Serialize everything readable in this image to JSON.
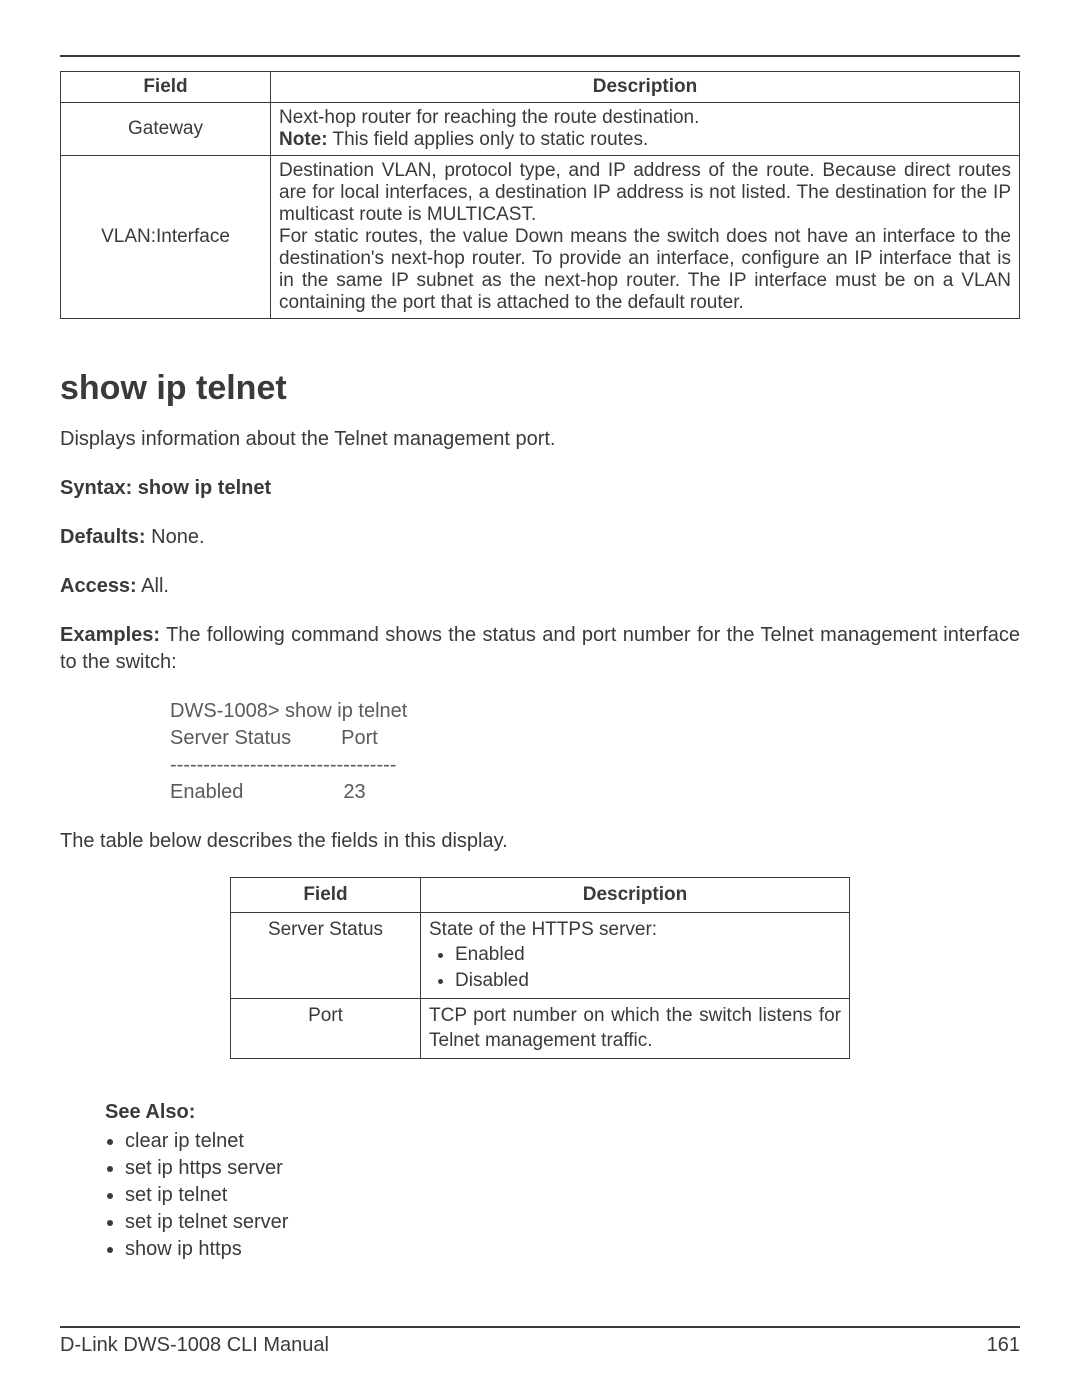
{
  "table1": {
    "headers": {
      "field": "Field",
      "description": "Description"
    },
    "rows": [
      {
        "field": "Gateway",
        "desc_line1": "Next-hop router for reaching the route destination.",
        "desc_note_label": "Note:",
        "desc_note_text": " This field applies only to static routes."
      },
      {
        "field": "VLAN:Interface",
        "desc_p1": "Destination VLAN, protocol type, and IP address of the route. Because direct routes are for local interfaces, a destination IP address is not listed. The destination for the IP multicast route is MULTICAST.",
        "desc_p2": "For static routes, the value Down means the switch does not have an interface to the destination's next-hop router. To provide an interface, configure an IP interface that is in the same IP subnet as the next-hop router. The IP interface must be on a VLAN containing the port that is attached to the default router."
      }
    ]
  },
  "command_heading": "show ip telnet",
  "intro": "Displays information about the Telnet management port.",
  "syntax_label": "Syntax: show ip telnet",
  "defaults_label": "Defaults:",
  "defaults_value": " None.",
  "access_label": "Access:",
  "access_value": " All.",
  "examples_label": "Examples:",
  "examples_text": " The following command shows the status and port number for the Telnet management interface to the switch:",
  "cli": "DWS-1008> show ip telnet\nServer Status         Port\n----------------------------------\nEnabled                  23",
  "desc_intro": "The table below describes the fields in this display.",
  "table2": {
    "headers": {
      "field": "Field",
      "description": "Description"
    },
    "rows": [
      {
        "field": "Server Status",
        "desc_line": "State of the HTTPS server:",
        "bullets": [
          "Enabled",
          "Disabled"
        ]
      },
      {
        "field": "Port",
        "desc": "TCP port number on which the switch listens for Telnet management traffic."
      }
    ]
  },
  "see_also_label": "See Also:",
  "see_also": [
    "clear ip telnet",
    "set ip https server",
    "set ip telnet",
    "set ip telnet server",
    "show ip https"
  ],
  "footer_left": "D-Link DWS-1008 CLI Manual",
  "footer_right": "161"
}
